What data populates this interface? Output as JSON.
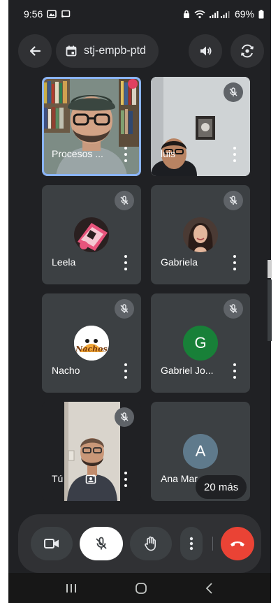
{
  "status_bar": {
    "time": "9:56",
    "battery": "69%"
  },
  "meeting": {
    "code": "stj-empb-ptd"
  },
  "participants": [
    {
      "name": "Procesos ...",
      "muted": false,
      "video": true
    },
    {
      "name": "luis",
      "muted": true,
      "video": true
    },
    {
      "name": "Leela",
      "muted": true,
      "video": false
    },
    {
      "name": "Gabriela",
      "muted": true,
      "video": false
    },
    {
      "name": "Nacho",
      "muted": true,
      "video": false
    },
    {
      "name": "Gabriel Jo...",
      "muted": true,
      "video": false,
      "initial": "G"
    },
    {
      "name": "Tú",
      "muted": true,
      "video": true
    },
    {
      "name": "Ana Mar",
      "muted": false,
      "video": false,
      "initial": "A"
    }
  ],
  "more_participants": "20 más",
  "nacho_avatar_text": "Nachos",
  "colors": {
    "background": "#202124",
    "tile": "#3c4043",
    "button": "#303134",
    "hangup": "#ea4335",
    "active_ring": "#8ab4f8",
    "avatar_green": "#188038",
    "avatar_blue": "#5f7a8c"
  }
}
